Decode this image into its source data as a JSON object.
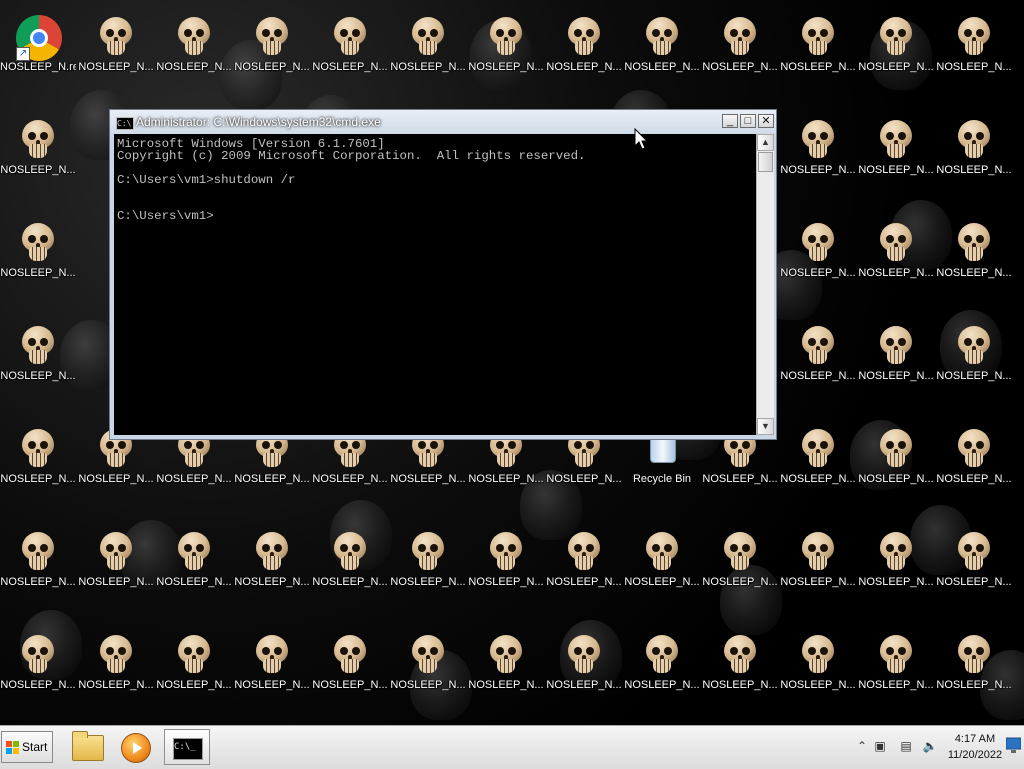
{
  "desktop": {
    "icon_label": "NOSLEEP_N...",
    "first_icon_label": "NOSLEEP_N.re",
    "recycle_label": "Recycle Bin"
  },
  "cmd_window": {
    "title": "Administrator: C:\\Windows\\system32\\cmd.exe",
    "titleicon_text": "C:\\",
    "min_symbol": "_",
    "max_symbol": "□",
    "close_symbol": "✕",
    "lines": [
      "Microsoft Windows [Version 6.1.7601]",
      "Copyright (c) 2009 Microsoft Corporation.  All rights reserved.",
      "",
      "C:\\Users\\vm1>shutdown /r",
      "",
      "",
      "C:\\Users\\vm1>"
    ]
  },
  "taskbar": {
    "start_label": "Start",
    "cmd_icon_text": "C:\\_",
    "tray_chevron": "⌃",
    "time": "4:17 AM",
    "date": "11/20/2022"
  },
  "icon_names": [
    "skull-icon",
    "chrome-icon",
    "recycle-bin-icon",
    "windows-logo-icon",
    "folder-icon",
    "media-player-icon",
    "cmd-icon",
    "speaker-icon",
    "network-icon",
    "action-center-icon"
  ]
}
